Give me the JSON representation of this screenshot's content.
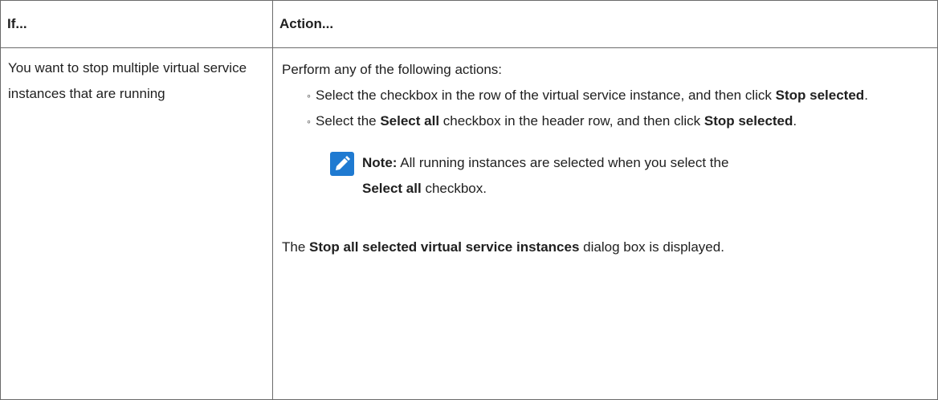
{
  "table": {
    "headers": [
      "If...",
      "Action..."
    ],
    "row": {
      "condition": "You want to stop multiple vir­tual service instances that are running",
      "intro": "Perform any of the following actions:",
      "items": [
        {
          "pre": "Select the checkbox in the row of the virtual service instance, and then click ",
          "bold": "Stop selected",
          "post": "."
        },
        {
          "pre": "Select the ",
          "bold": "Select all",
          "mid": " checkbox in the header row, and then click ",
          "bold2": "Stop selected",
          "post": "."
        }
      ],
      "note": {
        "label": "Note:",
        "text_pre": " All running instances are selected when you select the ",
        "bold": "Select all",
        "text_post": " checkbox."
      },
      "final": {
        "pre": "The ",
        "bold": "Stop all selected virtual service instances",
        "post": " dialog box is displayed."
      }
    }
  },
  "icons": {
    "note": "pencil-note-icon",
    "bullet": "◦"
  }
}
